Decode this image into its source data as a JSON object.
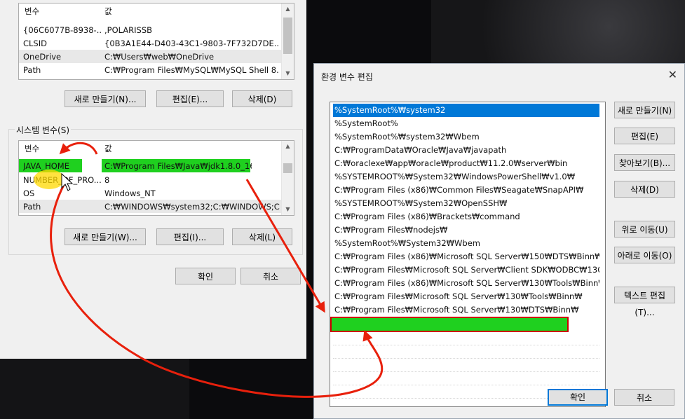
{
  "user_vars": {
    "col_name": "변수",
    "col_value": "값",
    "rows": [
      {
        "name": "{06C6077B-8938-...",
        "value": ",POLARISSB"
      },
      {
        "name": "CLSID",
        "value": "{0B3A1E44-D403-43C1-9803-7F732D7DE..."
      },
      {
        "name": "OneDrive",
        "value": "C:₩Users₩web₩OneDrive"
      },
      {
        "name": "Path",
        "value": "C:₩Program Files₩MySQL₩MySQL Shell 8...."
      }
    ],
    "new_label": "새로 만들기(N)...",
    "edit_label": "편집(E)...",
    "delete_label": "삭제(D)"
  },
  "system_vars": {
    "group_label": "시스템 변수(S)",
    "col_name": "변수",
    "col_value": "값",
    "rows": [
      {
        "name": "JAVA_HOME",
        "value": "C:₩Program Files₩Java₩jdk1.8.0_161"
      },
      {
        "name": "NUMBER_OF_PRO...",
        "value": "8"
      },
      {
        "name": "OS",
        "value": "Windows_NT"
      },
      {
        "name": "Path",
        "value": "C:₩WINDOWS₩system32;C:₩WINDOWS;C..."
      }
    ],
    "new_label": "새로 만들기(W)...",
    "edit_label": "편집(I)...",
    "delete_label": "삭제(L)"
  },
  "main_ok": "확인",
  "main_cancel": "취소",
  "edit_dialog": {
    "title": "환경 변수 편집",
    "close": "✕",
    "items": [
      "%SystemRoot%₩system32",
      "%SystemRoot%",
      "%SystemRoot%₩system32₩Wbem",
      "C:₩ProgramData₩Oracle₩Java₩javapath",
      "C:₩oraclexe₩app₩oracle₩product₩11.2.0₩server₩bin",
      "%SYSTEMROOT%₩System32₩WindowsPowerShell₩v1.0₩",
      "C:₩Program Files (x86)₩Common Files₩Seagate₩SnapAPI₩",
      "%SYSTEMROOT%₩System32₩OpenSSH₩",
      "C:₩Program Files (x86)₩Brackets₩command",
      "C:₩Program Files₩nodejs₩",
      "%SystemRoot%₩System32₩Wbem",
      "C:₩Program Files (x86)₩Microsoft SQL Server₩150₩DTS₩Binn₩",
      "C:₩Program Files₩Microsoft SQL Server₩Client SDK₩ODBC₩130₩T...",
      "C:₩Program Files (x86)₩Microsoft SQL Server₩130₩Tools₩Binn₩",
      "C:₩Program Files₩Microsoft SQL Server₩130₩Tools₩Binn₩",
      "C:₩Program Files₩Microsoft SQL Server₩130₩DTS₩Binn₩"
    ],
    "buttons": {
      "new": "새로 만들기(N)",
      "edit": "편집(E)",
      "browse": "찾아보기(B)...",
      "delete": "삭제(D)",
      "move_up": "위로 이동(U)",
      "move_down": "아래로 이동(O)",
      "edit_text": "텍스트 편집(T)...",
      "ok": "확인",
      "cancel": "취소"
    }
  },
  "colors": {
    "highlight_green": "#1fd01f",
    "annotation_red": "#e8200c",
    "selection_blue": "#0078d7"
  }
}
